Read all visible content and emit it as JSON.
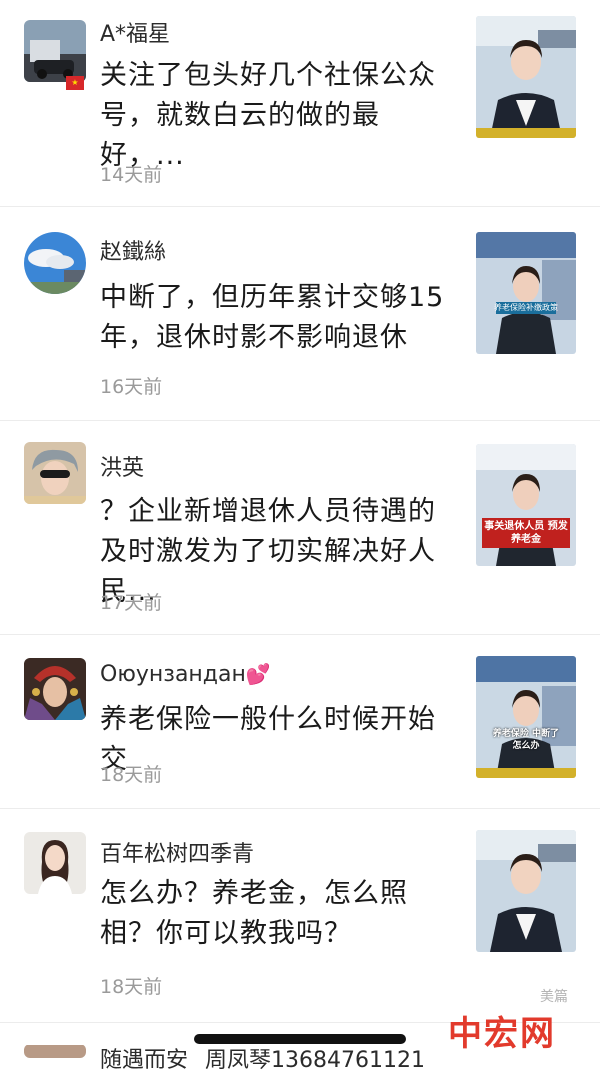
{
  "comments": [
    {
      "user": "A*福星",
      "flag": "🇨🇳",
      "message": "关注了包头好几个社保公众号，就数白云的做的最好，...",
      "time": "14天前",
      "thumb_caption": ""
    },
    {
      "user": "赵鐵絲",
      "message": "中断了，但历年累计交够15年，退休时影不影响退休",
      "time": "16天前",
      "thumb_caption": "养老保险补缴政策"
    },
    {
      "user": "洪英",
      "message": "？企业新增退休人员待遇的及时激发为了切实解决好人民...",
      "time": "17天前",
      "thumb_caption": "事关退休人员 预发养老金"
    },
    {
      "user": "Оюунзандан",
      "emoji": "💕",
      "message": "养老保险一般什么时候开始交",
      "time": "18天前",
      "thumb_caption": "养老保险 中断了怎么办"
    },
    {
      "user": "百年松树四季青",
      "message": "怎么办？养老金，怎么照相？你可以教我吗？",
      "time": "18天前",
      "thumb_caption": ""
    },
    {
      "user": "随遇而安",
      "message": "周凤琴13684761121",
      "time": ""
    }
  ],
  "watermark": {
    "brand": "中宏网",
    "small": "美篇"
  }
}
